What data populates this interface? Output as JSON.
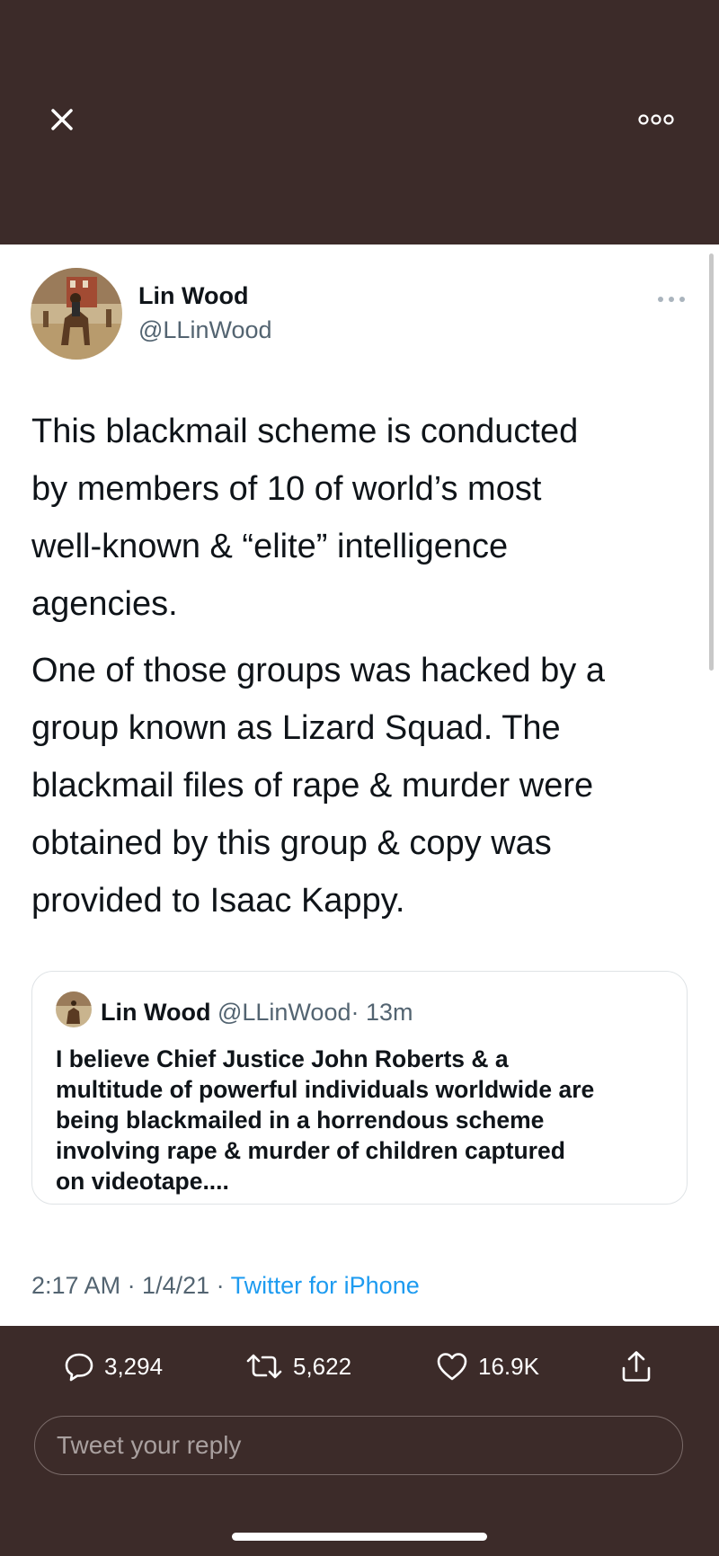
{
  "header": {
    "close_icon": "close-icon",
    "more_icon": "more-horizontal-icon"
  },
  "tweet": {
    "author": {
      "name": "Lin Wood",
      "handle": "@LLinWood"
    },
    "paragraphs": [
      "This blackmail scheme is conducted\nby members of 10 of world’s most\nwell-known & “elite” intelligence\nagencies.",
      "One of those groups was hacked by a\ngroup known as Lizard Squad. The\nblackmail files of rape & murder were\nobtained by this group & copy was\nprovided to Isaac Kappy."
    ],
    "quote": {
      "name": "Lin Wood",
      "handle": "@LLinWood",
      "separator": "·",
      "time": "13m",
      "text": "I believe Chief Justice John Roberts & a\nmultitude of powerful individuals worldwide are\nbeing blackmailed in a horrendous scheme\ninvolving rape & murder of children captured\non videotape...."
    },
    "timestamp": "2:17 AM · 1/4/21 ·",
    "source": "Twitter for iPhone"
  },
  "actions": {
    "replies": "3,294",
    "retweets": "5,622",
    "likes": "16.9K"
  },
  "reply_input": {
    "placeholder": "Tweet your reply"
  },
  "colors": {
    "background": "#3c2b29",
    "card": "#ffffff",
    "link": "#1d9bf0",
    "secondary_text": "#536471"
  }
}
